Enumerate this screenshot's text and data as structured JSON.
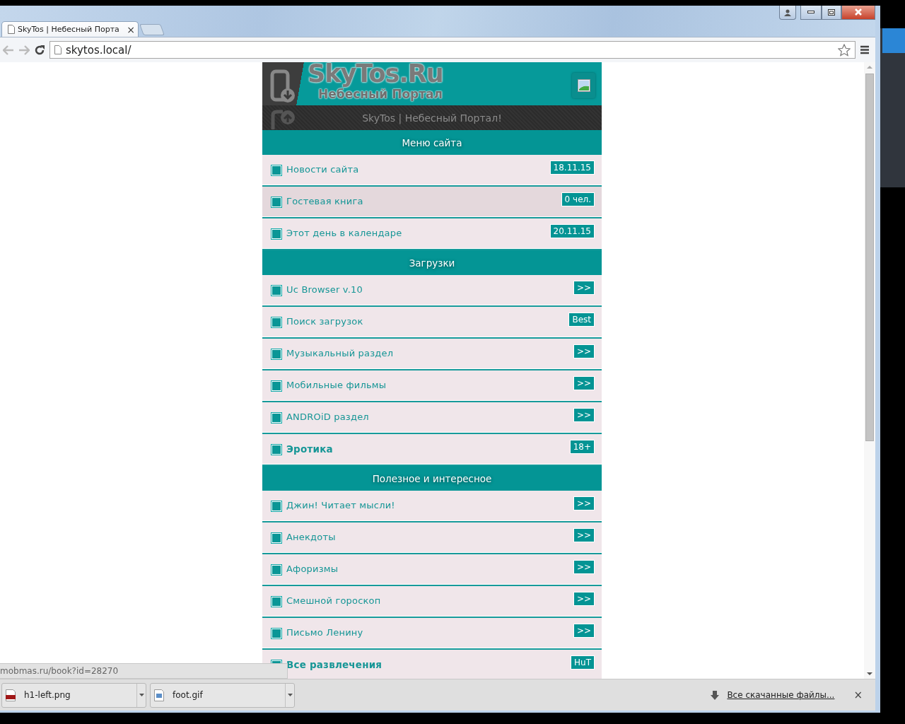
{
  "browser": {
    "tabs": [
      {
        "title": "SkyTos | Небесный Порта",
        "close": "×",
        "selected": true
      }
    ],
    "url": "skytos.local/",
    "status": "mobmas.ru/book?id=28270"
  },
  "page": {
    "logo_title": "SkyTos.Ru",
    "logo_subtitle": "Небесный Портал",
    "tagline": "SkyTos | Небесный Портал!",
    "sections": [
      {
        "title": "Меню сайта",
        "items": [
          {
            "label": "Новости сайта",
            "badge": "18.11.15",
            "bold": false,
            "highlighted": false
          },
          {
            "label": "Гостевая книга",
            "badge": "0 чел.",
            "bold": false,
            "highlighted": true
          },
          {
            "label": "Этот день в календаре",
            "badge": "20.11.15",
            "bold": false,
            "highlighted": false
          }
        ]
      },
      {
        "title": "Загрузки",
        "items": [
          {
            "label": "Uc Browser v.10",
            "badge": ">>",
            "bold": false,
            "highlighted": false
          },
          {
            "label": "Поиск загрузок",
            "badge": "Best",
            "bold": false,
            "highlighted": false
          },
          {
            "label": "Музыкальный раздел",
            "badge": ">>",
            "bold": false,
            "highlighted": false
          },
          {
            "label": "Мобильные фильмы",
            "badge": ">>",
            "bold": false,
            "highlighted": false
          },
          {
            "label": "ANDROiD раздел",
            "badge": ">>",
            "bold": false,
            "highlighted": false
          },
          {
            "label": "Эротика",
            "badge": "18+",
            "bold": true,
            "highlighted": false
          }
        ]
      },
      {
        "title": "Полезное и интересное",
        "items": [
          {
            "label": "Джин! Читает мысли!",
            "badge": ">>",
            "bold": false,
            "highlighted": false
          },
          {
            "label": "Анекдоты",
            "badge": ">>",
            "bold": false,
            "highlighted": false
          },
          {
            "label": "Афоризмы",
            "badge": ">>",
            "bold": false,
            "highlighted": false
          },
          {
            "label": "Смешной гороскоп",
            "badge": ">>",
            "bold": false,
            "highlighted": false
          },
          {
            "label": "Письмо Ленину",
            "badge": ">>",
            "bold": false,
            "highlighted": false
          },
          {
            "label": "Все развлечения",
            "badge": "HuT",
            "bold": true,
            "highlighted": false
          }
        ]
      }
    ]
  },
  "downloads": {
    "items": [
      {
        "name": "h1-left.png",
        "kind": "png"
      },
      {
        "name": "foot.gif",
        "kind": "gif"
      }
    ],
    "show_all": "Все скачанные файлы...",
    "close": "×"
  }
}
